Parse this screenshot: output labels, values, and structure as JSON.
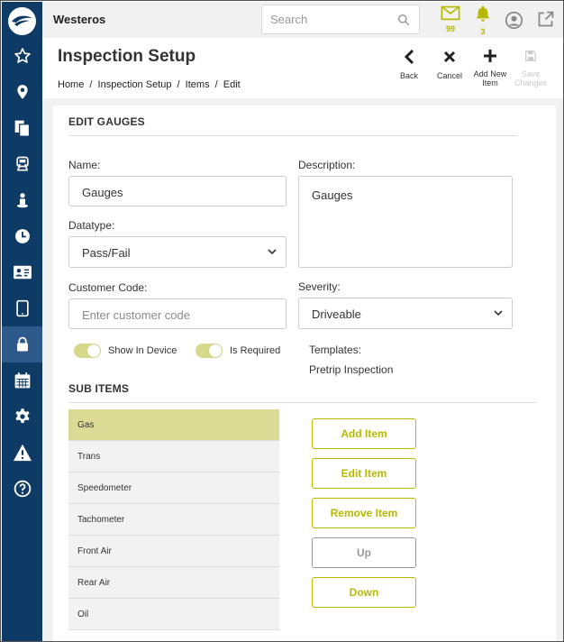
{
  "header": {
    "brand": "Westeros",
    "search_placeholder": "Search",
    "mail_count": "99",
    "alert_count": "3",
    "accent_color": "#b6b900",
    "sidebar_color": "#0e3a66"
  },
  "sidebar": {
    "items": [
      {
        "name": "star-icon"
      },
      {
        "name": "map-pin-icon"
      },
      {
        "name": "documents-icon"
      },
      {
        "name": "truck-icon"
      },
      {
        "name": "driver-icon"
      },
      {
        "name": "clock-icon"
      },
      {
        "name": "id-card-icon"
      },
      {
        "name": "tablet-icon"
      },
      {
        "name": "lock-icon",
        "active": true
      },
      {
        "name": "calendar-icon"
      },
      {
        "name": "gear-icon"
      },
      {
        "name": "warning-icon"
      },
      {
        "name": "help-icon"
      }
    ]
  },
  "page": {
    "title": "Inspection Setup",
    "breadcrumb": [
      "Home",
      "/",
      "Inspection Setup",
      "/",
      "Items",
      "/",
      "Edit"
    ]
  },
  "toolbar": {
    "back": "Back",
    "cancel": "Cancel",
    "add_new_line1": "Add New",
    "add_new_line2": "Item",
    "save_line1": "Save",
    "save_line2": "Changes"
  },
  "form": {
    "section_title": "EDIT GAUGES",
    "name_label": "Name:",
    "name_value": "Gauges",
    "description_label": "Description:",
    "description_value": "Gauges",
    "datatype_label": "Datatype:",
    "datatype_value": "Pass/Fail",
    "customer_code_label": "Customer Code:",
    "customer_code_placeholder": "Enter customer code",
    "severity_label": "Severity:",
    "severity_value": "Driveable",
    "show_in_device_label": "Show In Device",
    "show_in_device_on": true,
    "is_required_label": "Is Required",
    "is_required_on": true,
    "templates_label": "Templates:",
    "templates_value": "Pretrip Inspection"
  },
  "sub_items": {
    "section_title": "SUB ITEMS",
    "items": [
      "Gas",
      "Trans",
      "Speedometer",
      "Tachometer",
      "Front Air",
      "Rear Air",
      "Oil"
    ],
    "selected_index": 0,
    "buttons": {
      "add": "Add Item",
      "edit": "Edit Item",
      "remove": "Remove Item",
      "up": "Up",
      "down": "Down"
    }
  }
}
